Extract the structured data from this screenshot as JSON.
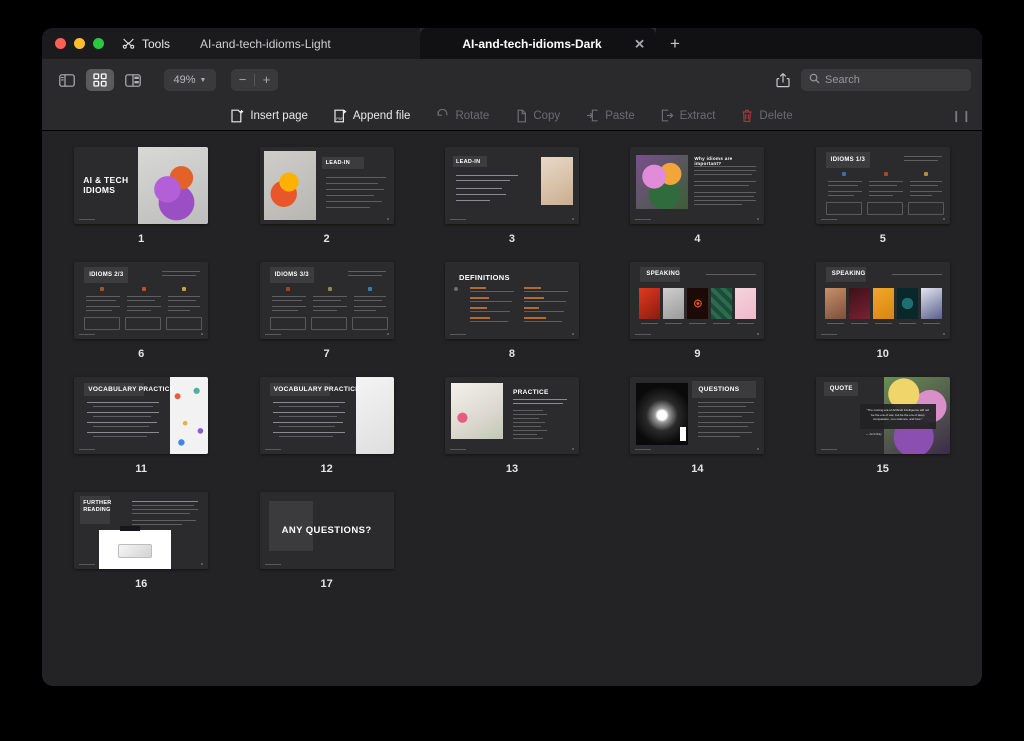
{
  "window": {
    "traffic_lights": [
      "close",
      "minimize",
      "zoom"
    ],
    "tools_label": "Tools",
    "tools_icon": "tools-icon"
  },
  "tabs": [
    {
      "label": "AI-and-tech-idioms-Light",
      "active": false
    },
    {
      "label": "AI-and-tech-idioms-Dark",
      "active": true,
      "close_icon": "close-icon"
    }
  ],
  "new_tab_icon": "plus-icon",
  "toolbar": {
    "sidebar_icon": "sidebar-panel-icon",
    "thumbnail_grid_icon": "thumbnail-grid-icon",
    "split_view_icon": "split-view-icon",
    "zoom_value": "49%",
    "zoom_chevron": "chevron-down-icon",
    "zoom_out_label": "−",
    "zoom_in_label": "+",
    "share_icon": "share-icon",
    "search_icon": "search-icon",
    "search_placeholder": "Search",
    "search_value": ""
  },
  "actions": [
    {
      "label": "Insert page",
      "icon": "insert-page-icon",
      "enabled": true
    },
    {
      "label": "Append file",
      "icon": "append-file-icon",
      "enabled": true
    },
    {
      "label": "Rotate",
      "icon": "rotate-icon",
      "enabled": false
    },
    {
      "label": "Copy",
      "icon": "copy-icon",
      "enabled": false
    },
    {
      "label": "Paste",
      "icon": "paste-icon",
      "enabled": false
    },
    {
      "label": "Extract",
      "icon": "extract-icon",
      "enabled": false
    },
    {
      "label": "Delete",
      "icon": "trash-icon",
      "enabled": false
    }
  ],
  "grip_icon": "resize-grip-icon",
  "pages": [
    {
      "number": "1",
      "kind": "title-split",
      "title": "AI & TECH IDIOMS",
      "image": "g1"
    },
    {
      "number": "2",
      "kind": "image-left",
      "title": "LEAD-IN",
      "image": "g2",
      "bullets": 6
    },
    {
      "number": "3",
      "kind": "image-right",
      "title": "LEAD-IN",
      "image": "g3",
      "bullets": 3
    },
    {
      "number": "4",
      "kind": "image-left-text",
      "title": "Why idioms are important?",
      "image": "g4"
    },
    {
      "number": "5",
      "kind": "three-col",
      "title": "IDIOMS 1/3",
      "subtitle": "Read the example sentence and match each idiom with its meaning"
    },
    {
      "number": "6",
      "kind": "three-col",
      "title": "IDIOMS 2/3",
      "subtitle": "Read the example sentence and match each idiom with its meaning"
    },
    {
      "number": "7",
      "kind": "three-col",
      "title": "IDIOMS 3/3",
      "subtitle": "Read the example sentence and match each idiom with its meaning"
    },
    {
      "number": "8",
      "kind": "definitions",
      "title": "DEFINITIONS"
    },
    {
      "number": "9",
      "kind": "speaking",
      "title": "SPEAKING",
      "subtitle": "Which idiom do these pictures make you think of?"
    },
    {
      "number": "10",
      "kind": "speaking",
      "title": "SPEAKING",
      "subtitle": "Which idiom do these pictures make you think of?"
    },
    {
      "number": "11",
      "kind": "vocab",
      "title": "VOCABULARY PRACTICE",
      "image": "g-confetti"
    },
    {
      "number": "12",
      "kind": "vocab",
      "title": "VOCABULARY PRACTICE",
      "image": "g-light"
    },
    {
      "number": "13",
      "kind": "practice",
      "title": "PRACTICE",
      "image": "g-desk"
    },
    {
      "number": "14",
      "kind": "questions",
      "title": "QUESTIONS",
      "image": "g-spot"
    },
    {
      "number": "15",
      "kind": "quote",
      "title": "QUOTE",
      "image": "g-quote",
      "quote_text": "\"The coming era of Artificial Intelligence will not be the era of war, but be the era of deep compassion, non-violence, and love.\"",
      "quote_author": "— Amit Ray"
    },
    {
      "number": "16",
      "kind": "further",
      "title": "FURTHER READING"
    },
    {
      "number": "17",
      "kind": "any-questions",
      "title": "ANY QUESTIONS?"
    }
  ]
}
